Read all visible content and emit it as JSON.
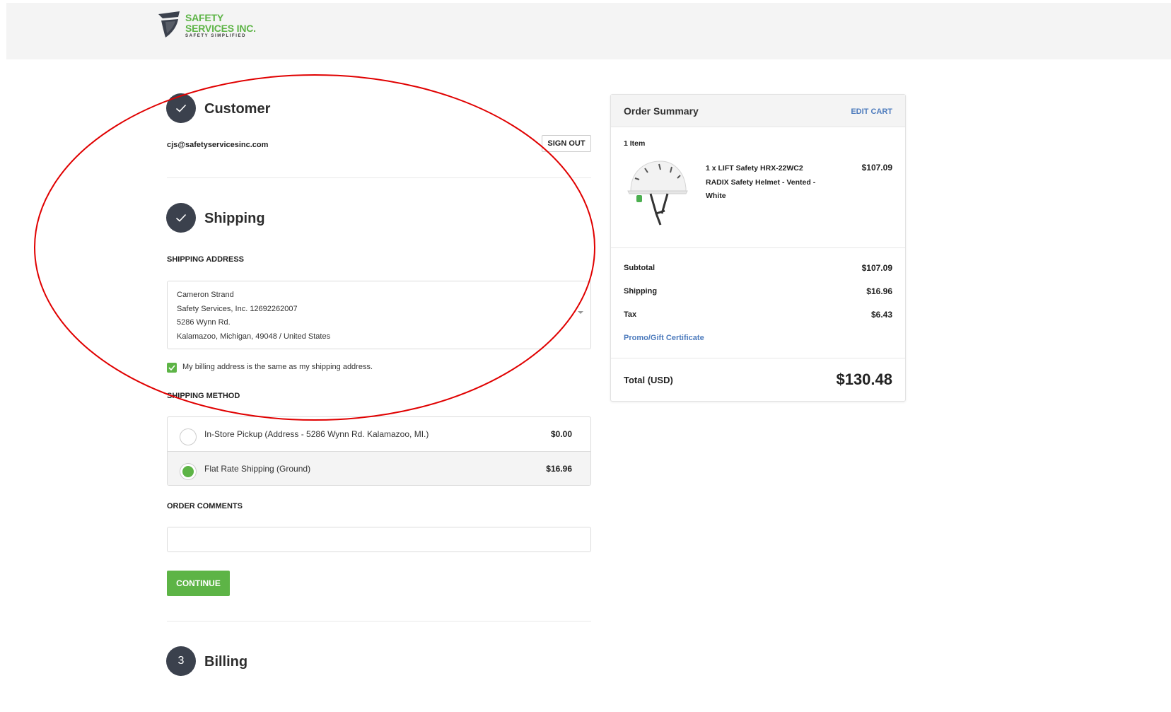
{
  "logo": {
    "line1": "SAFETY",
    "line2": "SERVICES INC.",
    "tagline": "SAFETY SIMPLIFIED",
    "brand_color": "#5db446"
  },
  "customer": {
    "title": "Customer",
    "email": "cjs@safetyservicesinc.com",
    "sign_out_label": "SIGN OUT",
    "step_icon": "check-icon"
  },
  "shipping": {
    "title": "Shipping",
    "step_icon": "check-icon",
    "address_heading": "SHIPPING ADDRESS",
    "address_lines": [
      "Cameron Strand",
      "Safety Services, Inc. 12692262007",
      "5286 Wynn Rd.",
      "Kalamazoo, Michigan, 49048 / United States"
    ],
    "billing_same_label": "My billing address is the same as my shipping address.",
    "billing_same_checked": true,
    "method_heading": "SHIPPING METHOD",
    "methods": [
      {
        "label": "In-Store Pickup (Address - 5286 Wynn Rd. Kalamazoo, MI.)",
        "price": "$0.00",
        "selected": false
      },
      {
        "label": "Flat Rate Shipping (Ground)",
        "price": "$16.96",
        "selected": true
      }
    ],
    "comments_heading": "ORDER COMMENTS",
    "comments_value": "",
    "continue_label": "CONTINUE"
  },
  "billing": {
    "step_number": "3",
    "title": "Billing"
  },
  "summary": {
    "title": "Order Summary",
    "edit_cart_label": "EDIT CART",
    "item_count": "1 Item",
    "product": {
      "lines": [
        "1 x LIFT Safety HRX-22WC2",
        "RADIX Safety Helmet - Vented -",
        "White"
      ],
      "price": "$107.09"
    },
    "subtotal_label": "Subtotal",
    "subtotal_value": "$107.09",
    "shipping_label": "Shipping",
    "shipping_value": "$16.96",
    "tax_label": "Tax",
    "tax_value": "$6.43",
    "promo_label": "Promo/Gift Certificate",
    "total_label": "Total (USD)",
    "total_value": "$130.48",
    "link_color": "#4d7bbd"
  },
  "annotation": {
    "shape": "ellipse",
    "color": "#e00000"
  }
}
